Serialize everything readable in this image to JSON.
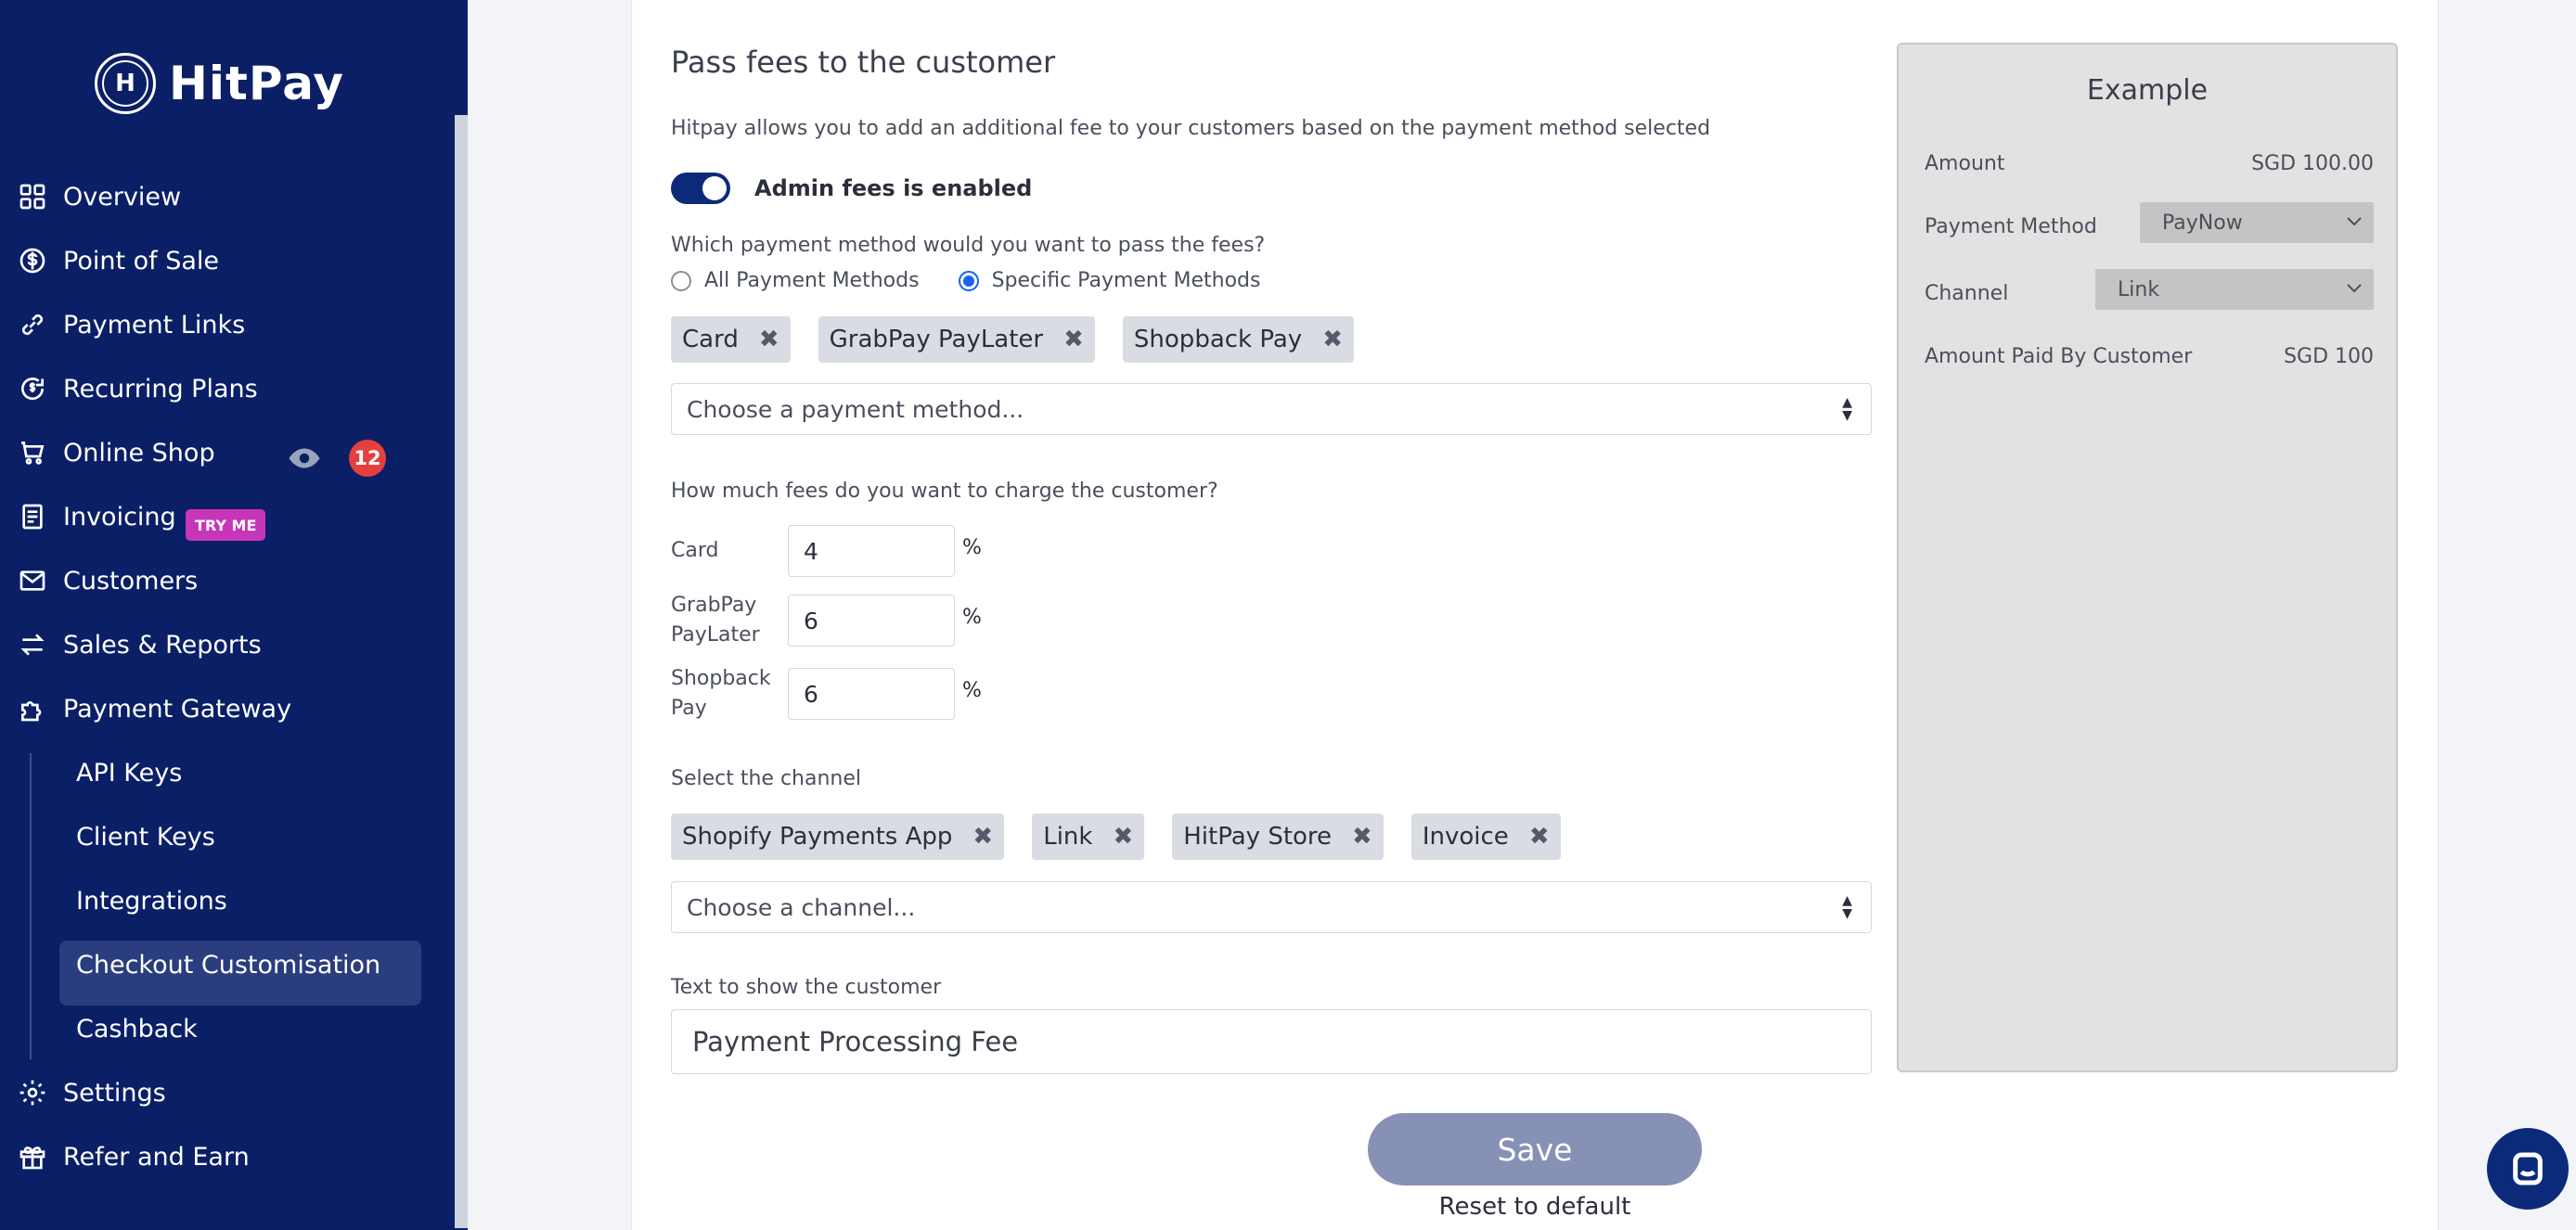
{
  "brand": {
    "name": "HitPay",
    "mark": "H"
  },
  "sidebar": {
    "items": [
      {
        "label": "Overview",
        "icon": "grid-icon"
      },
      {
        "label": "Point of Sale",
        "icon": "dollar-icon"
      },
      {
        "label": "Payment Links",
        "icon": "link-icon"
      },
      {
        "label": "Recurring Plans",
        "icon": "recurring-icon"
      },
      {
        "label": "Online Shop",
        "icon": "cart-icon",
        "badge": "12"
      },
      {
        "label": "Invoicing",
        "icon": "invoice-icon",
        "tag": "TRY ME"
      },
      {
        "label": "Customers",
        "icon": "mail-icon"
      },
      {
        "label": "Sales & Reports",
        "icon": "arrows-icon"
      },
      {
        "label": "Payment Gateway",
        "icon": "puzzle-icon"
      }
    ],
    "sub_items": [
      "API Keys",
      "Client Keys",
      "Integrations",
      "Checkout Customisation",
      "Cashback"
    ],
    "bottom_items": [
      {
        "label": "Settings",
        "icon": "gear-icon"
      },
      {
        "label": "Refer and Earn",
        "icon": "gift-icon"
      }
    ]
  },
  "form": {
    "title": "Pass fees to the customer",
    "description": "Hitpay allows you to add an additional fee to your customers based on the payment method selected",
    "toggle_label": "Admin fees is enabled",
    "method_question": "Which payment method would you want to pass the fees?",
    "radio_all": "All Payment Methods",
    "radio_specific": "Specific Payment Methods",
    "method_chips": [
      "Card",
      "GrabPay PayLater",
      "Shopback Pay"
    ],
    "method_placeholder": "Choose a payment method...",
    "fee_question": "How much fees do you want to charge the customer?",
    "fees": [
      {
        "label": "Card",
        "value": "4",
        "unit": "%"
      },
      {
        "label": "GrabPay PayLater",
        "value": "6",
        "unit": "%"
      },
      {
        "label": "Shopback Pay",
        "value": "6",
        "unit": "%"
      }
    ],
    "channel_question": "Select the channel",
    "channel_chips": [
      "Shopify Payments App",
      "Link",
      "HitPay Store",
      "Invoice"
    ],
    "channel_placeholder": "Choose a channel...",
    "text_label": "Text to show the customer",
    "text_value": "Payment Processing Fee",
    "save_label": "Save",
    "reset_label": "Reset to default"
  },
  "example": {
    "title": "Example",
    "amount_label": "Amount",
    "amount_value": "SGD 100.00",
    "method_label": "Payment Method",
    "method_value": "PayNow",
    "channel_label": "Channel",
    "channel_value": "Link",
    "paid_label": "Amount Paid By Customer",
    "paid_value": "SGD 100"
  },
  "colors": {
    "sidebar_bg": "#0b1f66",
    "accent": "#0b2a7a",
    "badge_red": "#e5403f",
    "try_me_pink": "#c736b8"
  }
}
